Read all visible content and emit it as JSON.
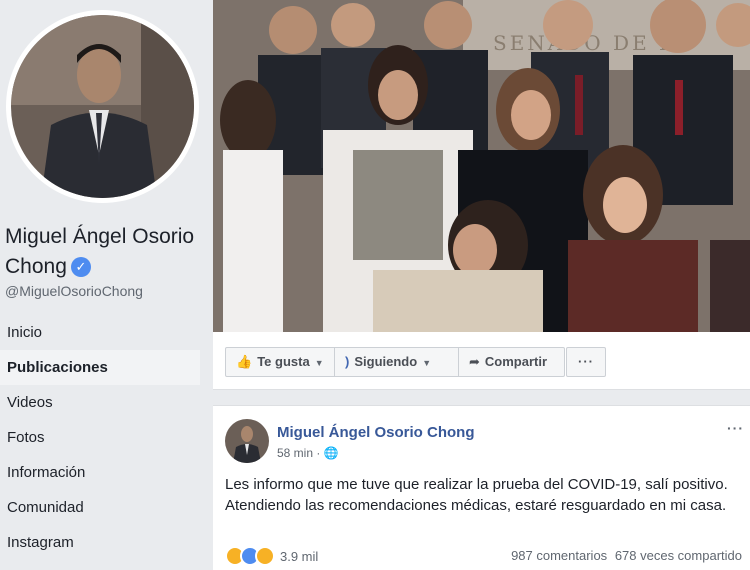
{
  "page": {
    "name": "Miguel Ángel Osorio Chong",
    "handle": "@MiguelOsorioChong"
  },
  "nav": {
    "items": [
      {
        "label": "Inicio",
        "active": false
      },
      {
        "label": "Publicaciones",
        "active": true
      },
      {
        "label": "Videos",
        "active": false
      },
      {
        "label": "Fotos",
        "active": false
      },
      {
        "label": "Información",
        "active": false
      },
      {
        "label": "Comunidad",
        "active": false
      },
      {
        "label": "Instagram",
        "active": false
      }
    ]
  },
  "actions": {
    "like_label": "Te gusta",
    "follow_label": "Siguiendo",
    "share_label": "Compartir",
    "more_label": "···"
  },
  "post": {
    "author": "Miguel Ángel Osorio Chong",
    "time": "58 min",
    "privacy_icon": "globe-icon",
    "more_label": "···",
    "text": "Les informo que me tuve que realizar la prueba del COVID-19, salí positivo. Atendiendo las recomendaciones médicas, estaré resguardado en mi casa.",
    "reactions_count": "3.9 mil",
    "comments": "987 comentarios",
    "shares": "678 veces compartido",
    "reaction_icons": [
      "wow-icon",
      "like-icon",
      "sad-icon"
    ]
  },
  "cover": {
    "background_text": "SENADO DE LA"
  },
  "colors": {
    "accent": "#4267b2",
    "link": "#385898",
    "verified": "#4e8cf0"
  }
}
